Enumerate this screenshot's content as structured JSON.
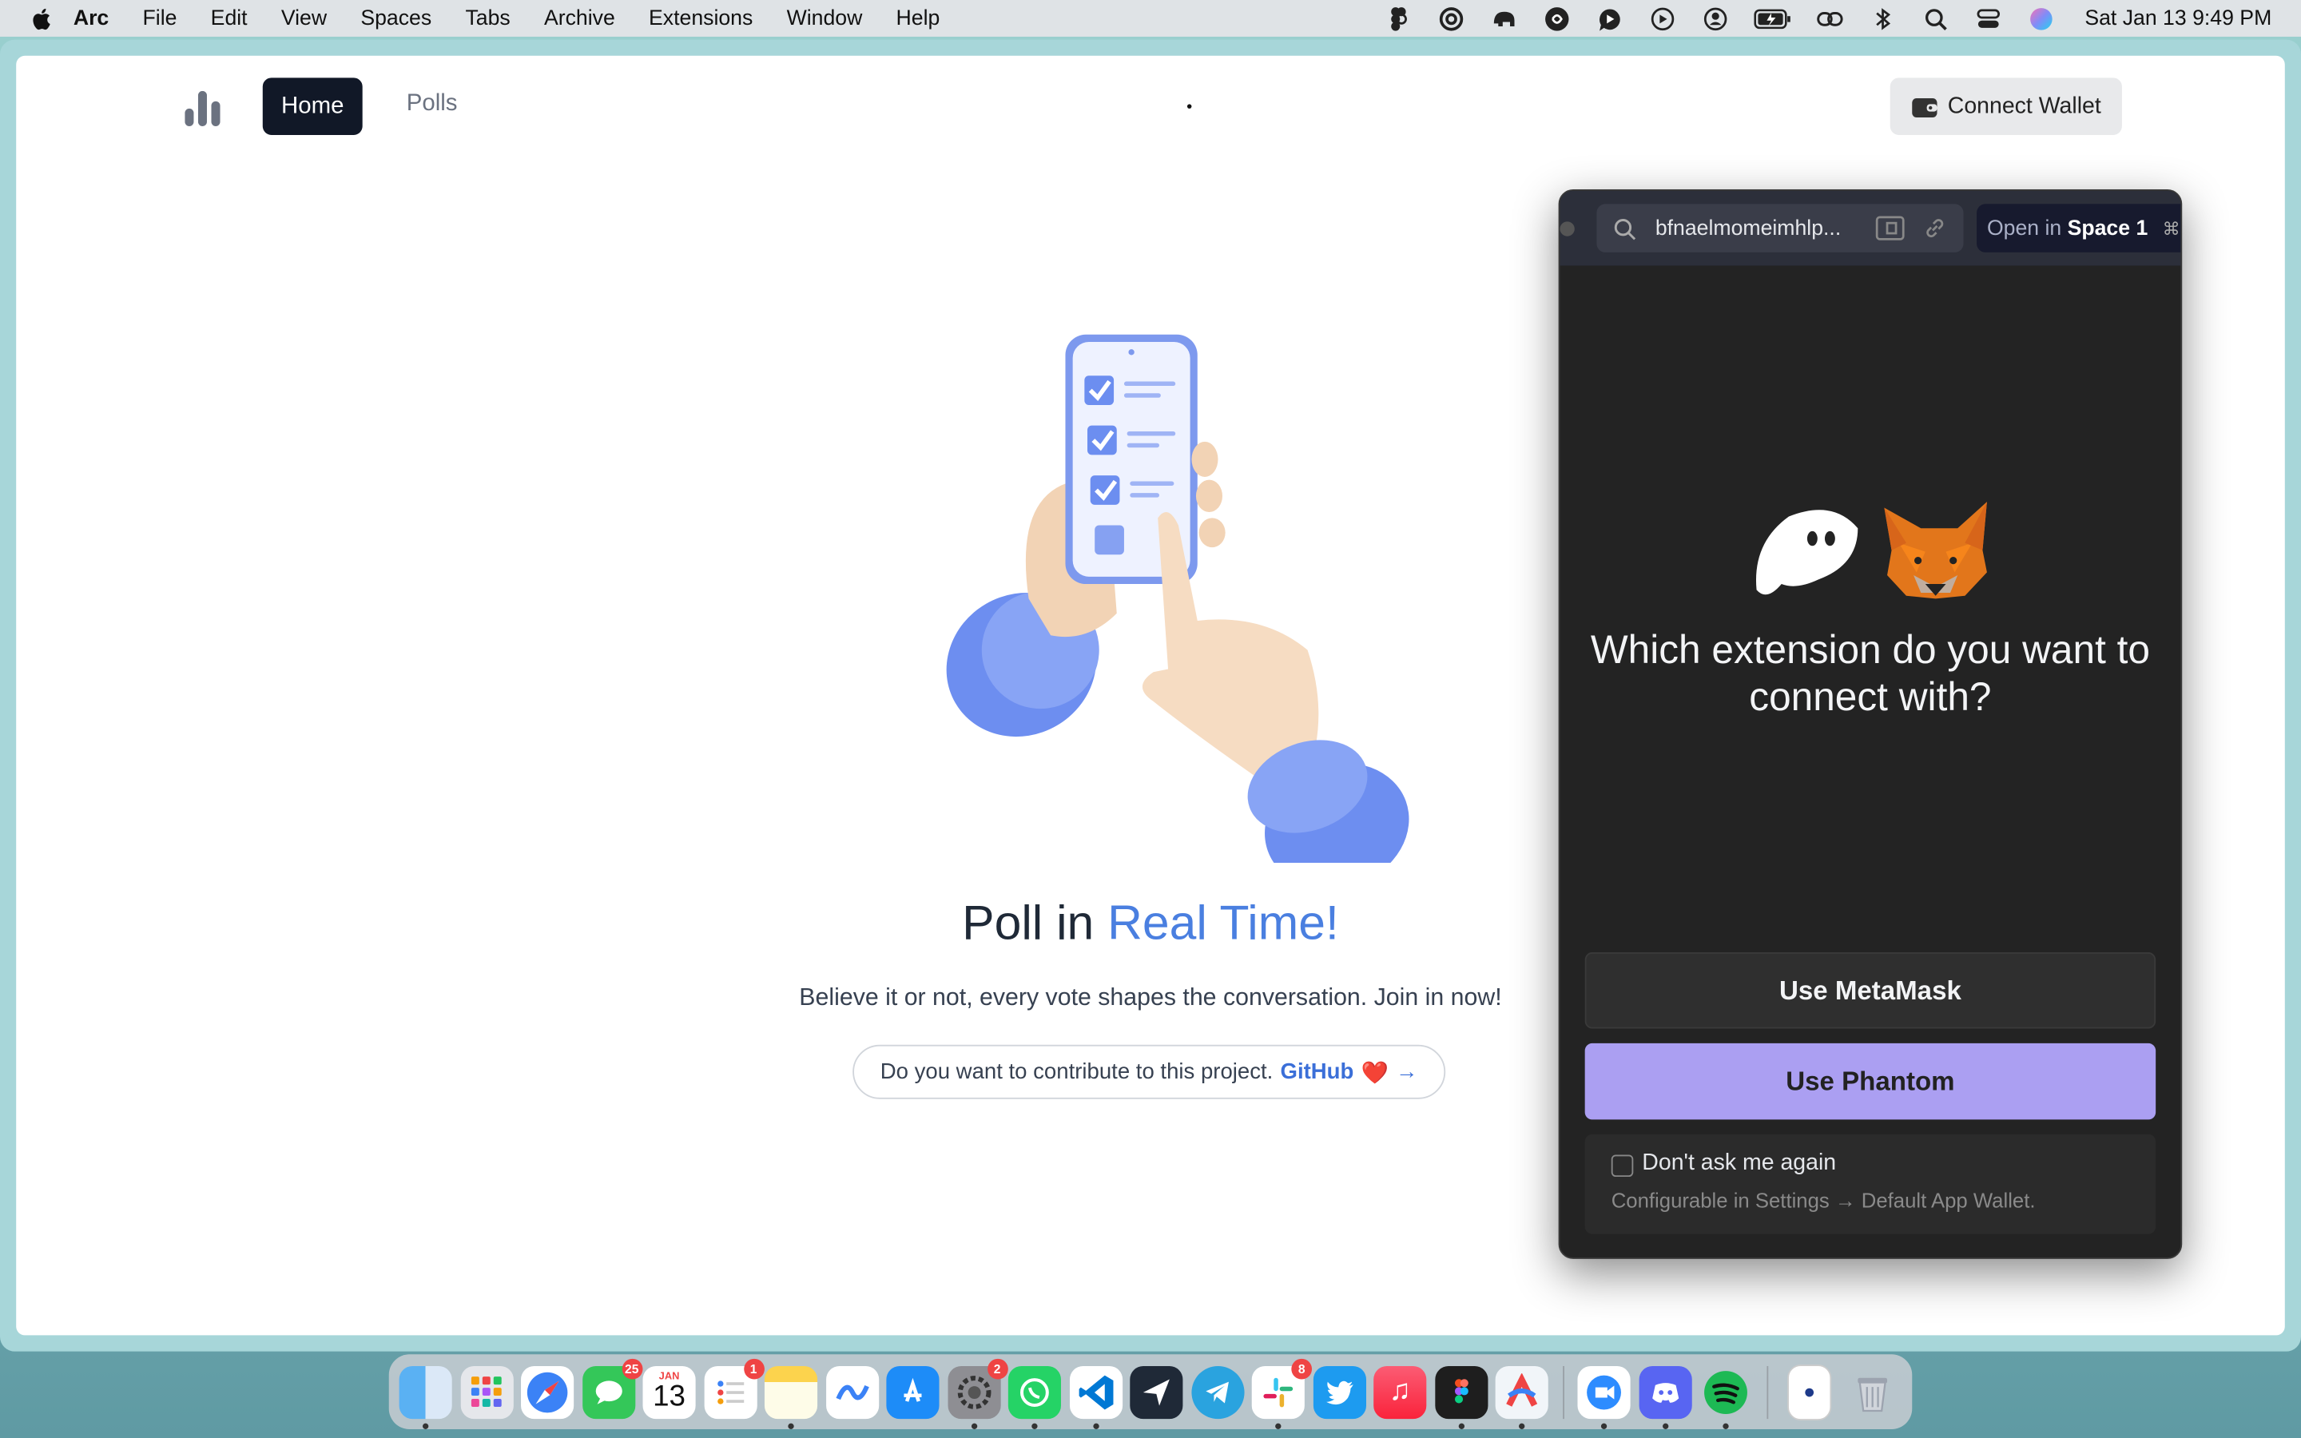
{
  "menubar": {
    "app_name": "Arc",
    "menus": [
      "File",
      "Edit",
      "View",
      "Spaces",
      "Tabs",
      "Archive",
      "Extensions",
      "Window",
      "Help"
    ],
    "clock": "Sat Jan 13  9:49 PM",
    "status_icons": [
      "figma-icon",
      "at-icon",
      "elephant-icon",
      "spiral-icon",
      "play-chat-icon",
      "play-circle-icon",
      "user-circle-icon",
      "battery-icon",
      "link-icon",
      "bluetooth-icon",
      "search-icon",
      "control-center-icon",
      "siri-icon"
    ]
  },
  "nav": {
    "home_label": "Home",
    "polls_label": "Polls",
    "connect_label": "Connect Wallet"
  },
  "hero": {
    "title_prefix": "Poll in ",
    "title_accent": "Real Time!",
    "subtitle": "Believe it or not, every vote shapes the conversation. Join in now!",
    "contrib_text": "Do you want to contribute to this project.",
    "contrib_link": "GitHub",
    "contrib_heart": "❤️",
    "contrib_arrow": "→"
  },
  "popup": {
    "url": "bfnaelmomeimhlp...",
    "open_in": "Open in",
    "space_name": "Space 1",
    "shortcut": "⌘O",
    "question": "Which extension do you want to connect with?",
    "metamask_label": "Use MetaMask",
    "phantom_label": "Use Phantom",
    "dont_ask_label": "Don't ask me again",
    "config_text": "Configurable in Settings → Default App Wallet."
  },
  "dock": {
    "badges": {
      "messages": "25",
      "reminders": "1",
      "settings": "2",
      "slack": "8"
    },
    "calendar_month": "JAN",
    "calendar_day": "13"
  },
  "colors": {
    "accent_blue": "#4a7fe0",
    "phantom_purple": "#ab9ff2",
    "home_button_bg": "#111827"
  }
}
